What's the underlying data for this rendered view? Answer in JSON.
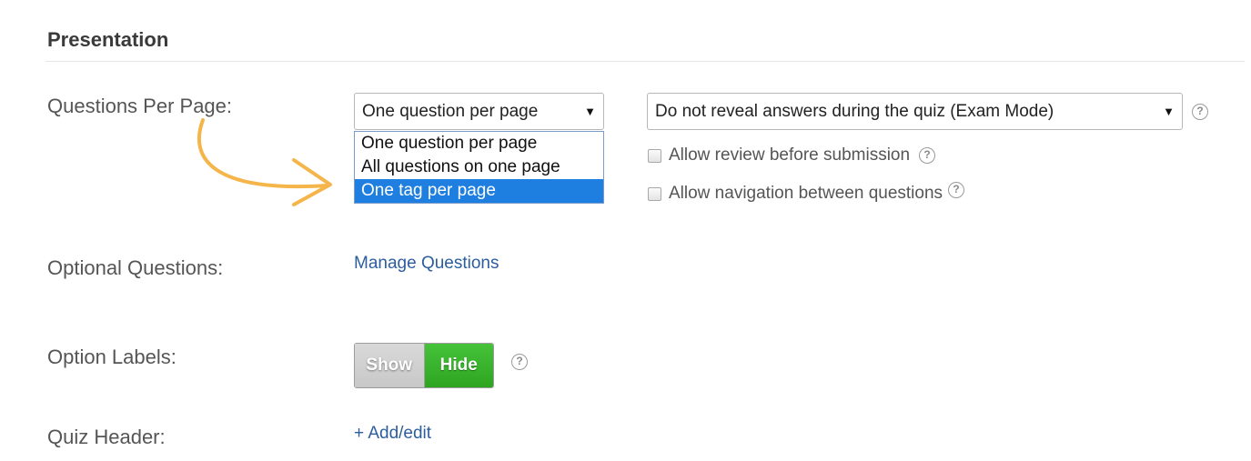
{
  "section": {
    "title": "Presentation"
  },
  "questions_per_page": {
    "label": "Questions Per Page:",
    "selected": "One question per page",
    "options": [
      "One question per page",
      "All questions on one page",
      "One tag per page"
    ],
    "highlighted_option": "One tag per page"
  },
  "reveal_mode": {
    "selected": "Do not reveal answers during the quiz (Exam Mode)"
  },
  "checkboxes": [
    {
      "label": "Allow review before submission",
      "checked": false
    },
    {
      "label": "Allow navigation between questions",
      "checked": false
    }
  ],
  "optional_questions": {
    "label": "Optional Questions:",
    "link": "Manage Questions"
  },
  "option_labels": {
    "label": "Option Labels:",
    "show": "Show",
    "hide": "Hide",
    "active": "Hide"
  },
  "quiz_header": {
    "label": "Quiz Header:",
    "link": "+ Add/edit"
  },
  "help_glyph": "?",
  "colors": {
    "accent": "#1e7fe0",
    "toggle_on": "#3cb82e",
    "link": "#2c5e9e",
    "arrow": "#f5b54a"
  }
}
